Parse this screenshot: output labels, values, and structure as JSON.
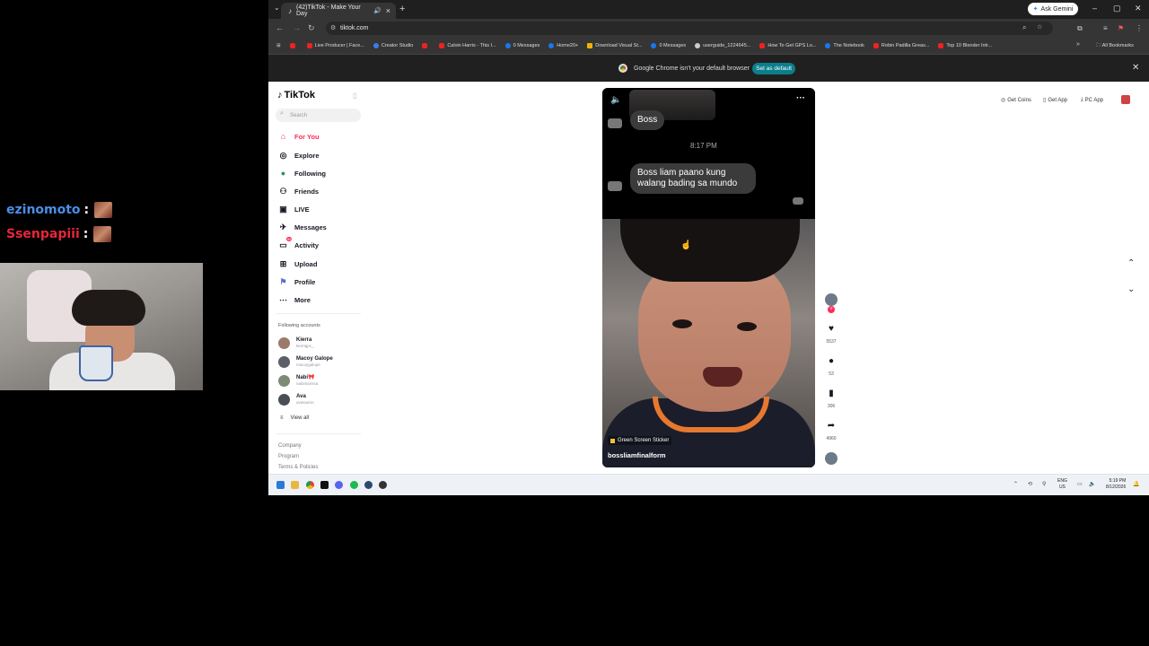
{
  "stream_chat": [
    {
      "user": "ezinomoto",
      "color": "#4a8fe8",
      "emote": "emote-image"
    },
    {
      "user": "Ssenpapiii",
      "color": "#e8253b",
      "emote": "emote-image"
    }
  ],
  "browser": {
    "tab_title": "(42)TikTok - Make Your Day",
    "new_tab": "+",
    "ask_gemini": "Ask Gemini",
    "url": "tiktok.com",
    "bookmarks": [
      {
        "label": "",
        "color": "#e22"
      },
      {
        "label": "Live Producer | Face...",
        "color": "#ddd"
      },
      {
        "label": "Creator Studio",
        "color": "#3b7ded"
      },
      {
        "label": "",
        "color": "#e22"
      },
      {
        "label": "Calvin Harris - This I...",
        "color": "#ddd"
      },
      {
        "label": "0 Messages",
        "color": "#1877f2"
      },
      {
        "label": "Home20+",
        "color": "#1877f2"
      },
      {
        "label": "Download Visual St...",
        "color": "#f2b200"
      },
      {
        "label": "0 Messages",
        "color": "#1877f2"
      },
      {
        "label": "userguide_1224645...",
        "color": "#ddd"
      },
      {
        "label": "How To Get GPS Lo...",
        "color": "#e22"
      },
      {
        "label": "The Notebook",
        "color": "#1877f2"
      },
      {
        "label": "Robin Padilla Greas...",
        "color": "#e22"
      },
      {
        "label": "Top 10 Blender Intr...",
        "color": "#e22"
      }
    ],
    "all_bookmarks": "All Bookmarks",
    "infobar_text": "Google Chrome isn't your default browser",
    "set_default": "Set as default"
  },
  "tiktok": {
    "logo": "TikTok",
    "search_placeholder": "Search",
    "nav": [
      {
        "label": "For You",
        "icon": "home-icon",
        "active": true
      },
      {
        "label": "Explore",
        "icon": "compass-icon"
      },
      {
        "label": "Following",
        "icon": "following-icon"
      },
      {
        "label": "Friends",
        "icon": "friends-icon"
      },
      {
        "label": "LIVE",
        "icon": "live-icon"
      },
      {
        "label": "Messages",
        "icon": "messages-icon"
      },
      {
        "label": "Activity",
        "icon": "activity-icon",
        "badge": "55"
      },
      {
        "label": "Upload",
        "icon": "upload-icon"
      },
      {
        "label": "Profile",
        "icon": "profile-icon"
      },
      {
        "label": "More",
        "icon": "more-icon"
      }
    ],
    "following_title": "Following accounts",
    "following": [
      {
        "name": "Kierra",
        "handle": "kierrajpc_"
      },
      {
        "name": "Macoy Galope",
        "handle": "macoygalope"
      },
      {
        "name": "Nabi🎀",
        "handle": "nabimarissa"
      },
      {
        "name": "Ava",
        "handle": "avasuerio"
      }
    ],
    "view_all": "View all",
    "footer": [
      "Company",
      "Program",
      "Terms & Policies"
    ],
    "top_links": [
      {
        "label": "Get Coins",
        "icon": "coin-icon"
      },
      {
        "label": "Get App",
        "icon": "phone-icon"
      },
      {
        "label": "PC App",
        "icon": "download-icon"
      }
    ]
  },
  "video": {
    "bubble_1": "Boss",
    "timestamp": "8:17 PM",
    "bubble_2": "Boss liam paano kung walang bading sa mundo",
    "sticker": "Green Screen Sticker",
    "author": "bossliamfinalform",
    "likes": "5537",
    "comments": "53",
    "saves": "306",
    "shares": "4960"
  },
  "taskbar": {
    "lang_1": "ENG",
    "lang_2": "US",
    "time": "5:19 PM",
    "date": "8/12/2026"
  }
}
